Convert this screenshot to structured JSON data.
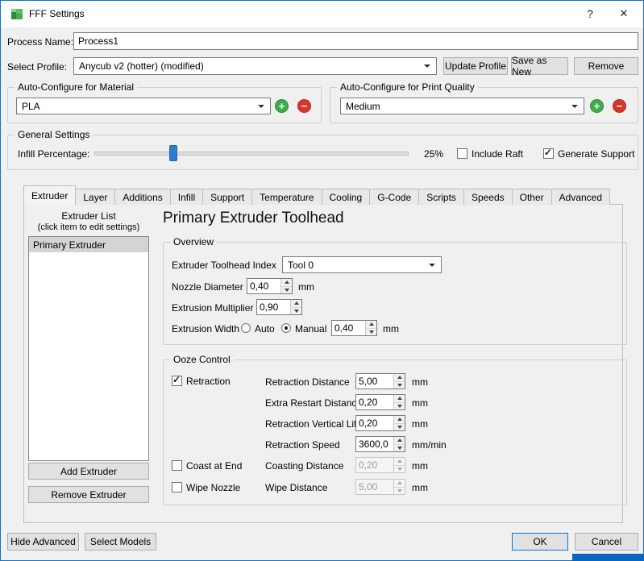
{
  "window": {
    "title": "FFF Settings"
  },
  "icons": {
    "help": "?",
    "close": "✕",
    "add": "+",
    "remove": "−",
    "check": "✓"
  },
  "colors": {
    "accent_blue": "#0078d7",
    "add_green": "#3fae49",
    "remove_red": "#d9342b",
    "slider_thumb": "#2d7dd2"
  },
  "header": {
    "process_name_label": "Process Name:",
    "process_name_value": "Process1",
    "select_profile_label": "Select Profile:",
    "profile_value": "Anycub v2 (hotter) (modified)",
    "update_profile_button": "Update Profile",
    "save_as_new_button": "Save as New",
    "remove_button": "Remove"
  },
  "auto_configure": {
    "material_group_title": "Auto-Configure for Material",
    "material_value": "PLA",
    "quality_group_title": "Auto-Configure for Print Quality",
    "quality_value": "Medium"
  },
  "general": {
    "group_title": "General Settings",
    "infill_label": "Infill Percentage:",
    "infill_value": "25%",
    "include_raft_label": "Include Raft",
    "generate_support_label": "Generate Support"
  },
  "tabs": [
    "Extruder",
    "Layer",
    "Additions",
    "Infill",
    "Support",
    "Temperature",
    "Cooling",
    "G-Code",
    "Scripts",
    "Speeds",
    "Other",
    "Advanced"
  ],
  "extruder_tab": {
    "list_title": "Extruder List",
    "list_subtitle": "(click item to edit settings)",
    "list_items": [
      "Primary Extruder"
    ],
    "add_extruder_button": "Add Extruder",
    "remove_extruder_button": "Remove Extruder",
    "heading": "Primary Extruder Toolhead",
    "overview": {
      "group_title": "Overview",
      "toolhead_index_label": "Extruder Toolhead Index",
      "toolhead_index_value": "Tool 0",
      "nozzle_diameter_label": "Nozzle Diameter",
      "nozzle_diameter_value": "0,40",
      "nozzle_diameter_unit": "mm",
      "extrusion_multiplier_label": "Extrusion Multiplier",
      "extrusion_multiplier_value": "0,90",
      "extrusion_width_label": "Extrusion Width",
      "auto_option": "Auto",
      "manual_option": "Manual",
      "extrusion_width_value": "0,40",
      "extrusion_width_unit": "mm"
    },
    "ooze": {
      "group_title": "Ooze Control",
      "retraction_checkbox": "Retraction",
      "retraction_distance_label": "Retraction Distance",
      "retraction_distance_value": "5,00",
      "retraction_distance_unit": "mm",
      "extra_restart_label": "Extra Restart Distance",
      "extra_restart_value": "0,20",
      "extra_restart_unit": "mm",
      "vertical_lift_label": "Retraction Vertical Lift",
      "vertical_lift_value": "0,20",
      "vertical_lift_unit": "mm",
      "retraction_speed_label": "Retraction Speed",
      "retraction_speed_value": "3600,0",
      "retraction_speed_unit": "mm/min",
      "coast_checkbox": "Coast at End",
      "coasting_distance_label": "Coasting Distance",
      "coasting_distance_value": "0,20",
      "coasting_distance_unit": "mm",
      "wipe_checkbox": "Wipe Nozzle",
      "wipe_distance_label": "Wipe Distance",
      "wipe_distance_value": "5,00",
      "wipe_distance_unit": "mm"
    }
  },
  "footer": {
    "hide_advanced_button": "Hide Advanced",
    "select_models_button": "Select Models",
    "ok_button": "OK",
    "cancel_button": "Cancel"
  }
}
